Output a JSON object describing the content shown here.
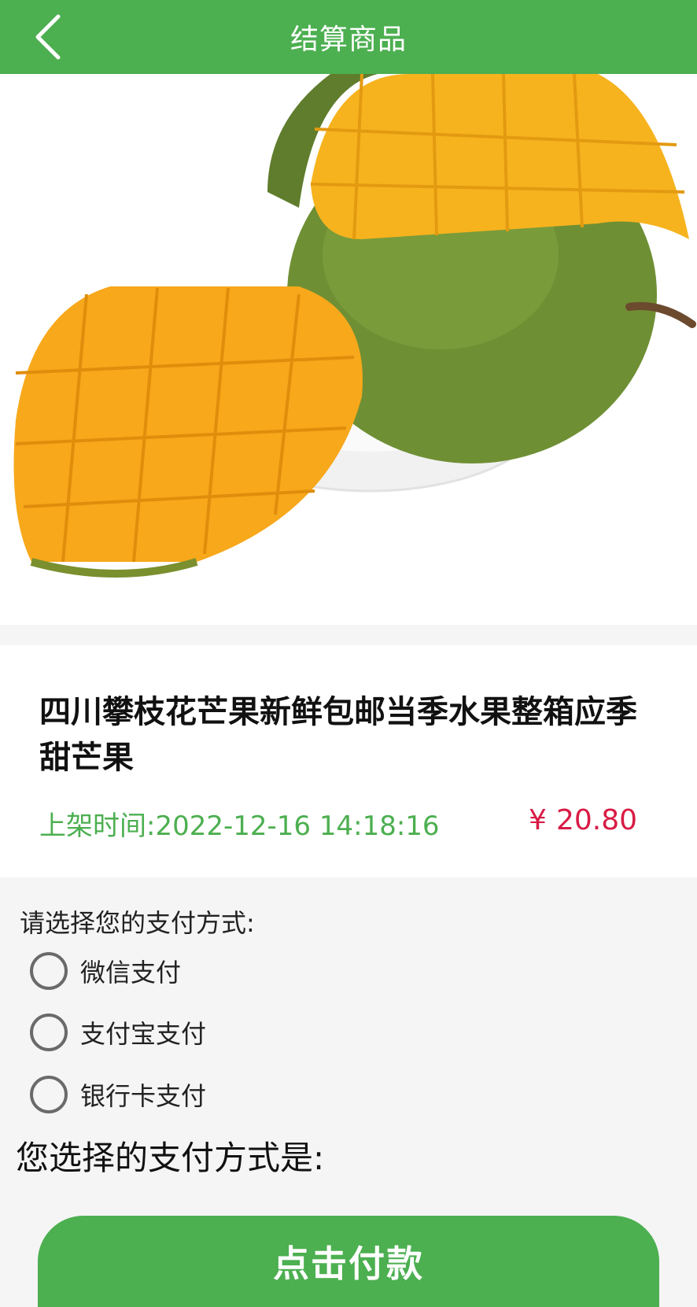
{
  "header": {
    "title": "结算商品",
    "back_icon": "chevron-left-icon"
  },
  "product": {
    "image_description_icon": "mango-image",
    "name": "四川攀枝花芒果新鲜包邮当季水果整箱应季甜芒果",
    "list_time": "上架时间:2022-12-16 14:18:16",
    "currency": "¥",
    "price": "20.80"
  },
  "payment": {
    "prompt": "请选择您的支付方式:",
    "options": [
      {
        "label": "微信支付",
        "selected": false
      },
      {
        "label": "支付宝支付",
        "selected": false
      },
      {
        "label": "银行卡支付",
        "selected": false
      }
    ],
    "selected_text": "您选择的支付方式是:"
  },
  "actions": {
    "pay_label": "点击付款"
  },
  "colors": {
    "primary": "#4caf50",
    "price": "#d81b45",
    "time": "#4caf50"
  }
}
